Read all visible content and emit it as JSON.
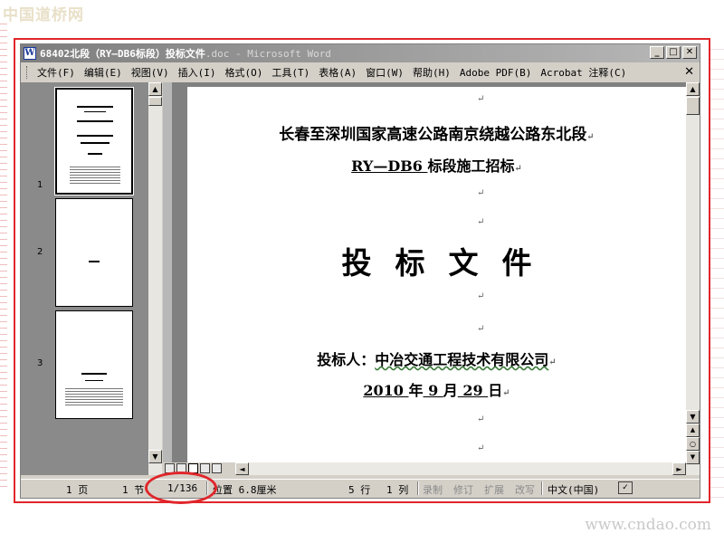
{
  "watermark": {
    "site_name": "中国道桥网",
    "site_url": "www.cndao.com"
  },
  "window": {
    "app_icon": "W",
    "title_main": "68402北段（RY—DB6标段）投标文件",
    "title_rest": ".doc - Microsoft Word",
    "minimize": "_",
    "maximize": "□",
    "close": "✕"
  },
  "menu": {
    "items": [
      {
        "label": "文件(F)"
      },
      {
        "label": "编辑(E)"
      },
      {
        "label": "视图(V)"
      },
      {
        "label": "插入(I)"
      },
      {
        "label": "格式(O)"
      },
      {
        "label": "工具(T)"
      },
      {
        "label": "表格(A)"
      },
      {
        "label": "窗口(W)"
      },
      {
        "label": "帮助(H)"
      },
      {
        "label": "Adobe PDF(B)"
      },
      {
        "label": "Acrobat 注释(C)"
      }
    ],
    "close": "✕"
  },
  "thumbnails": [
    {
      "page": "1"
    },
    {
      "page": "2"
    },
    {
      "page": "3"
    }
  ],
  "document": {
    "para_mark": "↵",
    "heading1": "长春至深圳国家高速公路南京绕越公路东北段",
    "heading2_underlined": "RY—DB6 ",
    "heading2_rest": "标段施工招标",
    "big_title": "投标文件",
    "bidder_label": "投标人：",
    "bidder_company": "中冶交通工程技术有限公司",
    "date_year": " 2010 ",
    "date_year_char": "年",
    "date_month": " 9 ",
    "date_month_char": "月",
    "date_day": " 29 ",
    "date_day_char": "日"
  },
  "scrollbar": {
    "up": "▲",
    "down": "▼",
    "left": "◄",
    "right": "►",
    "prev_page": "▲",
    "select_browse": "○",
    "next_page": "▼"
  },
  "status": {
    "page": "1 页",
    "section": "1 节",
    "page_of": "1/136",
    "position": "位置 6.8厘米",
    "line": "5 行",
    "column": "1 列",
    "rec": "录制",
    "trk": "修订",
    "ext": "扩展",
    "ovr": "改写",
    "language": "中文(中国)"
  },
  "colors": {
    "highlight": "#e0262b",
    "title_bar": "#8a8a8a"
  }
}
